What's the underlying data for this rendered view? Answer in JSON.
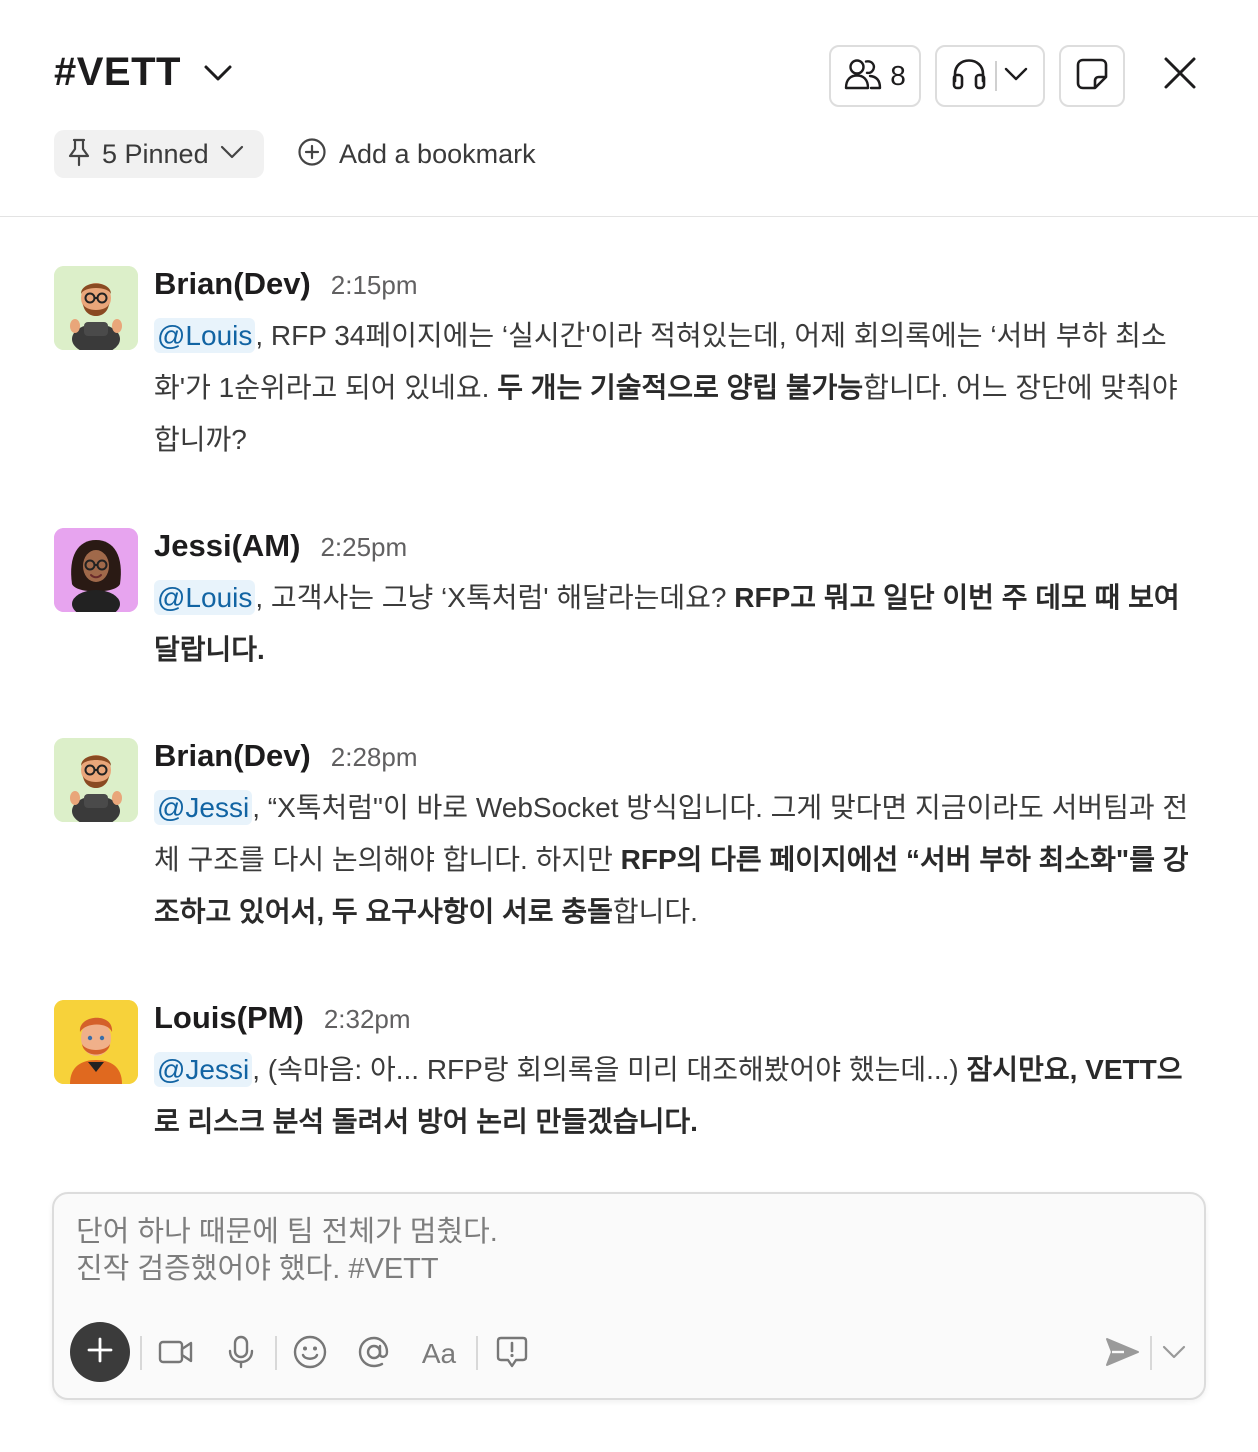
{
  "header": {
    "channel": "#VETT",
    "member_count": "8",
    "pinned_label": "5 Pinned",
    "bookmark_label": "Add a bookmark"
  },
  "messages": [
    {
      "sender": "Brian(Dev)",
      "time": "2:15pm",
      "mention": "@Louis",
      "text_1": ", RFP 34페이지에는 ‘실시간'이라 적혀있는데, 어제 회의록에는 ‘서버 부하 최소화'가 1순위라고 되어 있네요. ",
      "bold_1": "두 개는 기술적으로 양립 불가능",
      "text_2": "합니다. 어느 장단에 맞춰야 합니까?"
    },
    {
      "sender": "Jessi(AM)",
      "time": "2:25pm",
      "mention": "@Louis",
      "text_1": ", 고객사는 그냥 ‘X톡처럼' 해달라는데요? ",
      "bold_1": "RFP고 뭐고 일단 이번 주 데모 때 보여달랍니다."
    },
    {
      "sender": "Brian(Dev)",
      "time": "2:28pm",
      "mention": "@Jessi",
      "text_1": ", “X톡처럼\"이 바로 WebSocket 방식입니다. 그게 맞다면 지금이라도 서버팀과 전체 구조를 다시 논의해야 합니다. 하지만 ",
      "bold_1": "RFP의 다른 페이지에선 “서버 부하 최소화\"를 강조하고 있어서, 두 요구사항이 서로 충돌",
      "text_2": "합니다."
    },
    {
      "sender": "Louis(PM)",
      "time": "2:32pm",
      "mention": "@Jessi",
      "text_1": ", (속마음: 아... RFP랑 회의록을 미리 대조해봤어야 했는데...) ",
      "bold_1": "잠시만요, VETT으로 리스크 분석 돌려서 방어 논리 만들겠습니다."
    }
  ],
  "composer": {
    "text": "단어 하나 때문에 팀 전체가 멈췄다.\n진작 검증했어야 했다.  #VETT",
    "format_label": "Aa"
  },
  "colors": {
    "mention_bg": "#e8f3fb",
    "mention_text": "#1264a3",
    "avatar_brian_bg": "#dcefc9",
    "avatar_jessi_bg": "#e7a4ef",
    "avatar_louis_bg": "#f7d23a"
  }
}
